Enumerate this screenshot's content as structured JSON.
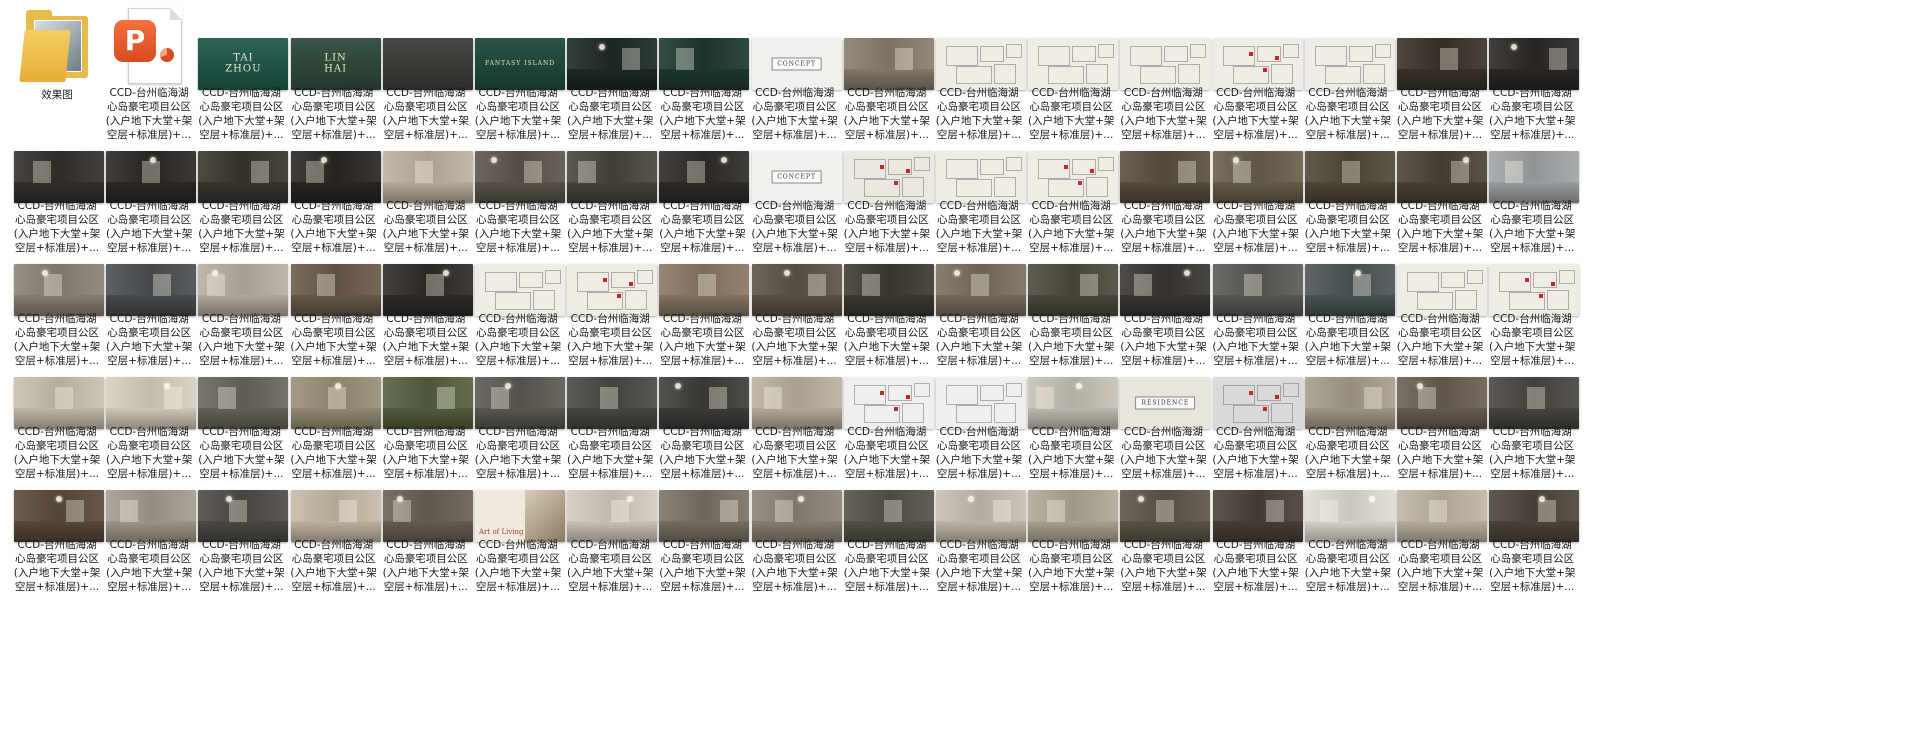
{
  "folder": {
    "name": "效果图",
    "icon": "folder-icon"
  },
  "pptx": {
    "label_lines": [
      "CCD-台州临海湖",
      "心岛豪宅项目公区",
      "(入户地下大堂+架",
      "空层+标准层)+..."
    ],
    "icon": "powerpoint-icon"
  },
  "file_label_lines": [
    "CCD-台州临海湖",
    "心岛豪宅项目公区",
    "(入户地下大堂+架",
    "空层+标准层)+..."
  ],
  "thumbnails": {
    "row1": [
      {
        "style": "title",
        "bg": "#1f5a4c",
        "words": [
          "TAI",
          "ZHOU"
        ],
        "color": "#e9e3cf"
      },
      {
        "style": "title",
        "bg": "#2f4a3a",
        "words": [
          "LIN",
          "HAI"
        ],
        "color": "#e9e3cf"
      },
      {
        "style": "title",
        "bg": "#3b3f37",
        "words": [
          "",
          ""
        ],
        "color": "#e9e3cf"
      },
      {
        "style": "title",
        "bg": "#1d4b39",
        "words": [
          "FANTASY ISLAND",
          ""
        ],
        "color": "#e6e0c6"
      },
      {
        "style": "photo",
        "bg": "#1d2a27"
      },
      {
        "style": "photo",
        "bg": "#1e3a30"
      },
      {
        "style": "concept",
        "bg": "#f1f0ec",
        "words": [
          "CONCEPT",
          ""
        ]
      },
      {
        "style": "photo",
        "bg": "#8a7e6d"
      },
      {
        "style": "plan",
        "bg": "#efece5"
      },
      {
        "style": "plan",
        "bg": "#efece5"
      },
      {
        "style": "plan",
        "bg": "#efece5"
      },
      {
        "style": "plan-red",
        "bg": "#efece5"
      },
      {
        "style": "plan",
        "bg": "#efece5"
      },
      {
        "style": "photo",
        "bg": "#3a332b"
      },
      {
        "style": "photo",
        "bg": "#2b2824"
      }
    ],
    "row2": [
      {
        "style": "photo",
        "bg": "#34302b"
      },
      {
        "style": "photo",
        "bg": "#2c2823"
      },
      {
        "style": "photo",
        "bg": "#3b352e"
      },
      {
        "style": "photo",
        "bg": "#2a2622"
      },
      {
        "style": "photo",
        "bg": "#bfb3a0"
      },
      {
        "style": "photo",
        "bg": "#5c554c"
      },
      {
        "style": "photo",
        "bg": "#4a453d"
      },
      {
        "style": "photo",
        "bg": "#2f2c28"
      },
      {
        "style": "concept",
        "bg": "#f1f0ec",
        "words": [
          "CONCEPT",
          ""
        ]
      },
      {
        "style": "plan-red",
        "bg": "#ebe8e2"
      },
      {
        "style": "plan",
        "bg": "#efece5"
      },
      {
        "style": "plan-red",
        "bg": "#efece5"
      },
      {
        "style": "photo",
        "bg": "#5a4f3e"
      },
      {
        "style": "photo",
        "bg": "#6a5f4c"
      },
      {
        "style": "photo",
        "bg": "#514838"
      },
      {
        "style": "photo",
        "bg": "#4b4337"
      },
      {
        "style": "photo",
        "bg": "#9fa6a8"
      }
    ],
    "row3": [
      {
        "style": "photo",
        "bg": "#8b8375"
      },
      {
        "style": "photo",
        "bg": "#4a4f52"
      },
      {
        "style": "photo",
        "bg": "#b9b0a1"
      },
      {
        "style": "photo",
        "bg": "#6b5b4a"
      },
      {
        "style": "photo",
        "bg": "#2f2b27"
      },
      {
        "style": "plan",
        "bg": "#efece5"
      },
      {
        "style": "plan-red",
        "bg": "#efece5"
      },
      {
        "style": "photo",
        "bg": "#8a7864"
      },
      {
        "style": "photo",
        "bg": "#5d5446"
      },
      {
        "style": "photo",
        "bg": "#3e3a33"
      },
      {
        "style": "photo",
        "bg": "#7a6f5e"
      },
      {
        "style": "photo",
        "bg": "#4d4a3e"
      },
      {
        "style": "photo",
        "bg": "#3a3731"
      },
      {
        "style": "photo",
        "bg": "#5b5a55"
      },
      {
        "style": "photo",
        "bg": "#4c5557"
      },
      {
        "style": "plan",
        "bg": "#efece5"
      },
      {
        "style": "plan-red",
        "bg": "#efece5"
      }
    ],
    "row4": [
      {
        "style": "photo",
        "bg": "#c9c0ae"
      },
      {
        "style": "photo",
        "bg": "#d8d0bf"
      },
      {
        "style": "photo",
        "bg": "#6a655c"
      },
      {
        "style": "photo",
        "bg": "#9a9077"
      },
      {
        "style": "photo",
        "bg": "#55603f"
      },
      {
        "style": "photo",
        "bg": "#5d5a52"
      },
      {
        "style": "photo",
        "bg": "#4a4a44"
      },
      {
        "style": "photo",
        "bg": "#3f3d38"
      },
      {
        "style": "photo",
        "bg": "#bcb1a0"
      },
      {
        "style": "plan-red",
        "bg": "#efefef"
      },
      {
        "style": "plan",
        "bg": "#efefef"
      },
      {
        "style": "photo",
        "bg": "#c8c2b7"
      },
      {
        "style": "concept",
        "bg": "#e9e5dc",
        "words": [
          "RESIDENCE",
          ""
        ]
      },
      {
        "style": "plan-red",
        "bg": "#dadada"
      },
      {
        "style": "photo",
        "bg": "#a89e8b"
      },
      {
        "style": "photo",
        "bg": "#6a5f52"
      },
      {
        "style": "photo",
        "bg": "#4a4640"
      }
    ],
    "row5": [
      {
        "style": "photo",
        "bg": "#5a4a3b"
      },
      {
        "style": "photo",
        "bg": "#a59d90"
      },
      {
        "style": "photo",
        "bg": "#4f4b45"
      },
      {
        "style": "photo",
        "bg": "#c7bba7"
      },
      {
        "style": "photo",
        "bg": "#6a6156"
      },
      {
        "style": "art",
        "bg": "#efe9df",
        "words": [
          "Art of Living",
          ""
        ]
      },
      {
        "style": "photo",
        "bg": "#d3ccc0"
      },
      {
        "style": "photo",
        "bg": "#7b7366"
      },
      {
        "style": "photo",
        "bg": "#8c8477"
      },
      {
        "style": "photo",
        "bg": "#56524a"
      },
      {
        "style": "photo",
        "bg": "#c7bfb1"
      },
      {
        "style": "photo",
        "bg": "#b2a995"
      },
      {
        "style": "photo",
        "bg": "#5d5649"
      },
      {
        "style": "photo",
        "bg": "#4a4139"
      },
      {
        "style": "photo",
        "bg": "#e2ddd5"
      },
      {
        "style": "photo",
        "bg": "#c0b6a5"
      },
      {
        "style": "photo",
        "bg": "#4d463c"
      }
    ]
  }
}
